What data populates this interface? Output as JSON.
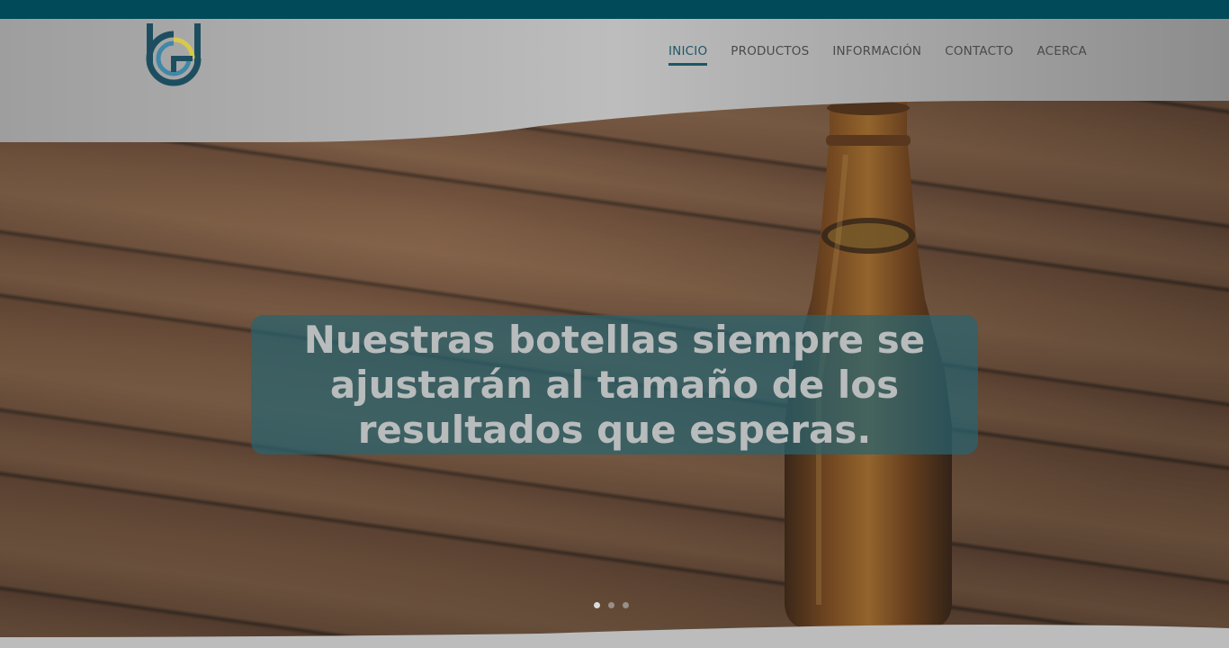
{
  "nav": {
    "items": [
      {
        "label": "INICIO",
        "active": true
      },
      {
        "label": "PRODUCTOS",
        "active": false
      },
      {
        "label": "INFORMACIÓN",
        "active": false
      },
      {
        "label": "CONTACTO",
        "active": false
      },
      {
        "label": "ACERCA",
        "active": false
      }
    ]
  },
  "hero": {
    "caption": "Nuestras botellas siempre se ajustarán al tamaño de los resultados que esperas.",
    "slides": 3,
    "active_slide": 1
  },
  "colors": {
    "topbar": "#004a5a",
    "accent": "#1d5666",
    "caption_bg": "#286470",
    "header_bg": "#b5b5b5"
  },
  "icons": {
    "logo": "company-logo-icon"
  }
}
